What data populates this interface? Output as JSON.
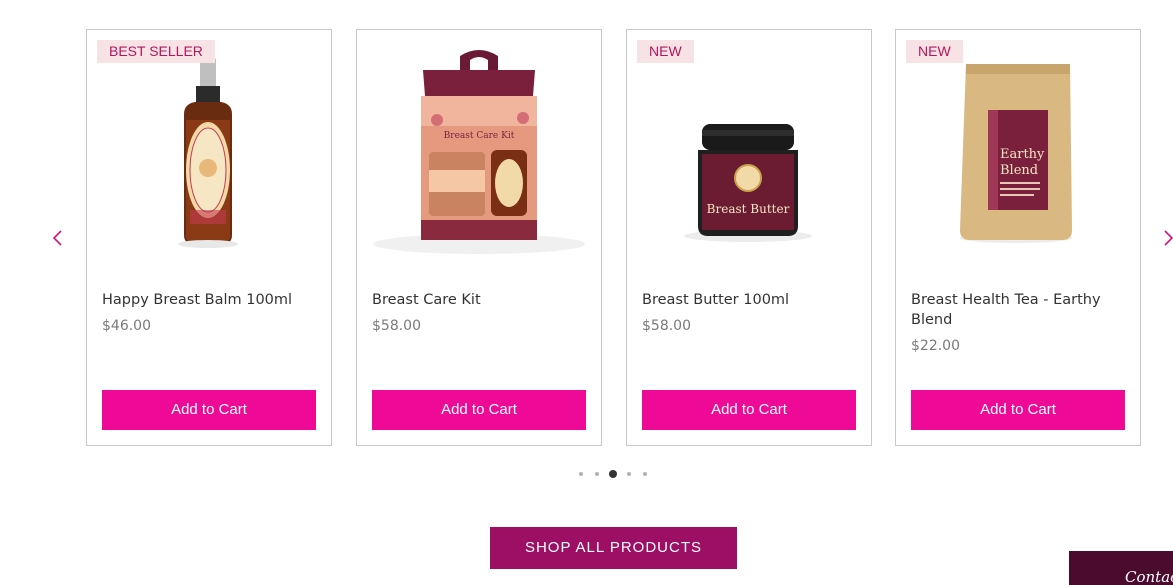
{
  "carousel": {
    "prev_icon": "chevron-left-icon",
    "next_icon": "chevron-right-icon",
    "accent_color": "#ee0a96",
    "products": [
      {
        "name": "Happy Breast Balm 100ml",
        "price": "$46.00",
        "badge": "BEST SELLER",
        "button": "Add to Cart",
        "image": "spray-bottle-image"
      },
      {
        "name": "Breast Care Kit",
        "price": "$58.00",
        "badge": "",
        "button": "Add to Cart",
        "image": "gift-box-image"
      },
      {
        "name": "Breast Butter 100ml",
        "price": "$58.00",
        "badge": "NEW",
        "button": "Add to Cart",
        "image": "jar-image"
      },
      {
        "name": "Breast Health Tea - Earthy Blend",
        "price": "$22.00",
        "badge": "NEW",
        "button": "Add to Cart",
        "image": "tea-pouch-image"
      }
    ],
    "pagination": {
      "count": 5,
      "active_index": 2
    }
  },
  "shop_all": {
    "label": "SHOP ALL PRODUCTS",
    "color": "#9c0f64"
  },
  "contact_tab": {
    "label": "Contact"
  },
  "colors": {
    "badge_bg": "#f7e3e6",
    "badge_text": "#b5155d"
  }
}
